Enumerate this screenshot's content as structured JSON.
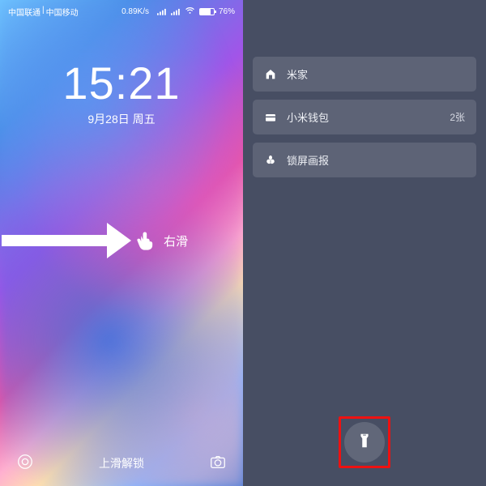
{
  "status": {
    "carrier1": "中国联通",
    "divider": " | ",
    "carrier2": "中国移动",
    "speed": "0.89K/s",
    "battery_pct": "76%"
  },
  "lock": {
    "time": "15:21",
    "date": "9月28日 周五",
    "swipe_label": "右滑",
    "unlock_hint": "上滑解锁"
  },
  "panel": {
    "items": [
      {
        "label": "米家",
        "trailing": ""
      },
      {
        "label": "小米钱包",
        "trailing": "2张"
      },
      {
        "label": "锁屏画报",
        "trailing": ""
      }
    ]
  }
}
